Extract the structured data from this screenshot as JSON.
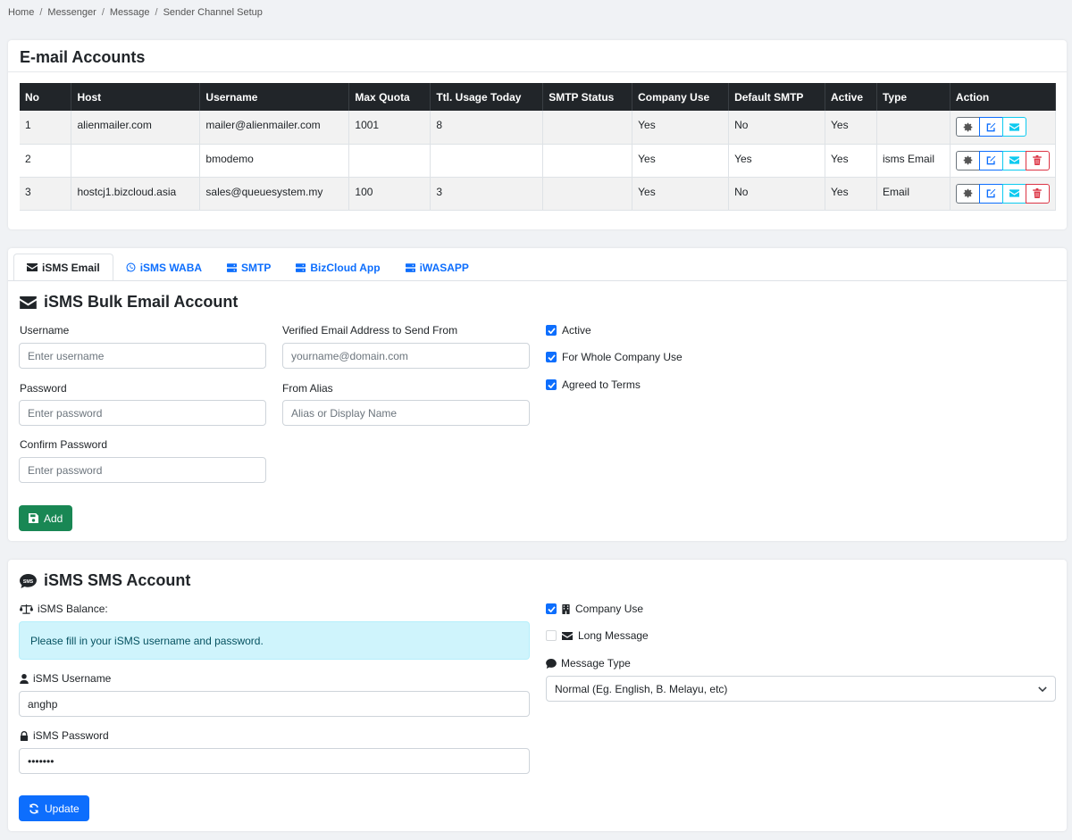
{
  "breadcrumb": [
    "Home",
    "Messenger",
    "Message",
    "Sender Channel Setup"
  ],
  "email_accounts": {
    "title": "E-mail Accounts",
    "columns": [
      "No",
      "Host",
      "Username",
      "Max Quota",
      "Ttl. Usage Today",
      "SMTP Status",
      "Company Use",
      "Default SMTP",
      "Active",
      "Type",
      "Action"
    ],
    "rows": [
      {
        "no": "1",
        "host": "alienmailer.com",
        "username": "mailer@alienmailer.com",
        "max_quota": "1001",
        "usage": "8",
        "smtp_status": "",
        "company_use": "Yes",
        "default_smtp": "No",
        "active": "Yes",
        "type": "",
        "delete": false
      },
      {
        "no": "2",
        "host": "",
        "username": "bmodemo",
        "max_quota": "",
        "usage": "",
        "smtp_status": "",
        "company_use": "Yes",
        "default_smtp": "Yes",
        "active": "Yes",
        "type": "isms Email",
        "delete": true
      },
      {
        "no": "3",
        "host": "hostcj1.bizcloud.asia",
        "username": "sales@queuesystem.my",
        "max_quota": "100",
        "usage": "3",
        "smtp_status": "",
        "company_use": "Yes",
        "default_smtp": "No",
        "active": "Yes",
        "type": "Email",
        "delete": true
      }
    ]
  },
  "tabs": [
    {
      "label": "iSMS Email",
      "icon": "envelope-icon",
      "active": true
    },
    {
      "label": "iSMS WABA",
      "icon": "whatsapp-icon",
      "active": false
    },
    {
      "label": "SMTP",
      "icon": "server-icon",
      "active": false
    },
    {
      "label": "BizCloud App",
      "icon": "server-icon",
      "active": false
    },
    {
      "label": "iWASAPP",
      "icon": "server-icon",
      "active": false
    }
  ],
  "bulk_form": {
    "title": "iSMS Bulk Email Account",
    "username_label": "Username",
    "username_placeholder": "Enter username",
    "password_label": "Password",
    "password_placeholder": "Enter password",
    "confirm_label": "Confirm Password",
    "confirm_placeholder": "Enter password",
    "email_label": "Verified Email Address to Send From",
    "email_placeholder": "yourname@domain.com",
    "alias_label": "From Alias",
    "alias_placeholder": "Alias or Display Name",
    "active_label": "Active",
    "active_checked": true,
    "company_label": "For Whole Company Use",
    "company_checked": true,
    "terms_label": "Agreed to Terms",
    "terms_checked": true,
    "add_label": "Add"
  },
  "sms": {
    "title": "iSMS SMS Account",
    "balance_label": "iSMS Balance:",
    "alert_text": "Please fill in your iSMS username and password.",
    "username_label": "iSMS Username",
    "username_value": "anghp",
    "password_label": "iSMS Password",
    "password_value": "•••••••",
    "company_use_label": "Company Use",
    "company_use_checked": true,
    "long_message_label": "Long Message",
    "long_message_checked": false,
    "message_type_label": "Message Type",
    "message_type_value": "Normal (Eg. English, B. Melayu, etc)",
    "update_label": "Update"
  },
  "colors": {
    "primary": "#0d6efd",
    "success": "#198754",
    "danger": "#dc3545",
    "info": "#0dcaf0",
    "dark": "#212529"
  }
}
